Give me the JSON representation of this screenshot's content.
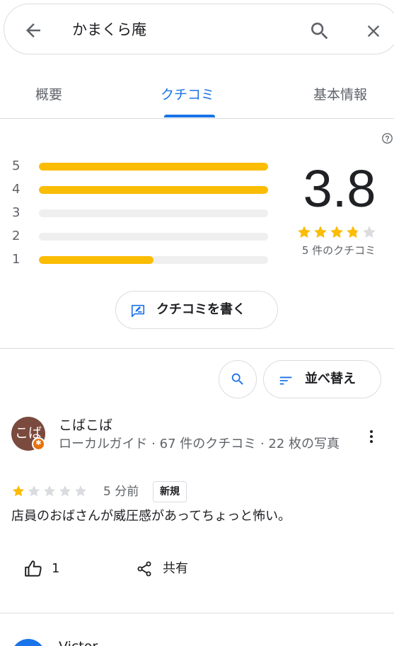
{
  "search": {
    "query": "かまくら庵"
  },
  "tabs": [
    {
      "label": "概要"
    },
    {
      "label": "クチコミ"
    },
    {
      "label": "基本情報"
    }
  ],
  "active_tab": "クチコミ",
  "rating": {
    "score": "3.8",
    "stars_value": 3.8,
    "count_label": "5 件のクチコミ",
    "histogram": [
      {
        "label": "5",
        "fraction": 1.0
      },
      {
        "label": "4",
        "fraction": 1.0
      },
      {
        "label": "3",
        "fraction": 0.0
      },
      {
        "label": "2",
        "fraction": 0.0
      },
      {
        "label": "1",
        "fraction": 0.5
      }
    ]
  },
  "actions": {
    "write_review": "クチコミを書く",
    "sort": "並べ替え"
  },
  "reviews": [
    {
      "avatar_text": "こば",
      "name": "こばこば",
      "meta": "ローカルガイド · 67 件のクチコミ · 22 枚の写真",
      "stars": 1,
      "time": "5 分前",
      "badge": "新規",
      "text": "店員のおばさんが威圧感があってちょっと怖い。",
      "likes": "1",
      "share_label": "共有"
    },
    {
      "name": "Victor"
    }
  ],
  "colors": {
    "accent": "#1a73e8",
    "star": "#fbbc04",
    "star_empty": "#dadce0",
    "avatar1": "#7b4a3e",
    "local_guide": "#e8710a"
  },
  "icons": [
    "back-arrow-icon",
    "search-icon",
    "close-icon",
    "help-icon",
    "edit-review-icon",
    "sort-icon",
    "guide-badge-icon",
    "more-vert-icon",
    "thumb-up-icon",
    "share-icon",
    "star-icon"
  ]
}
